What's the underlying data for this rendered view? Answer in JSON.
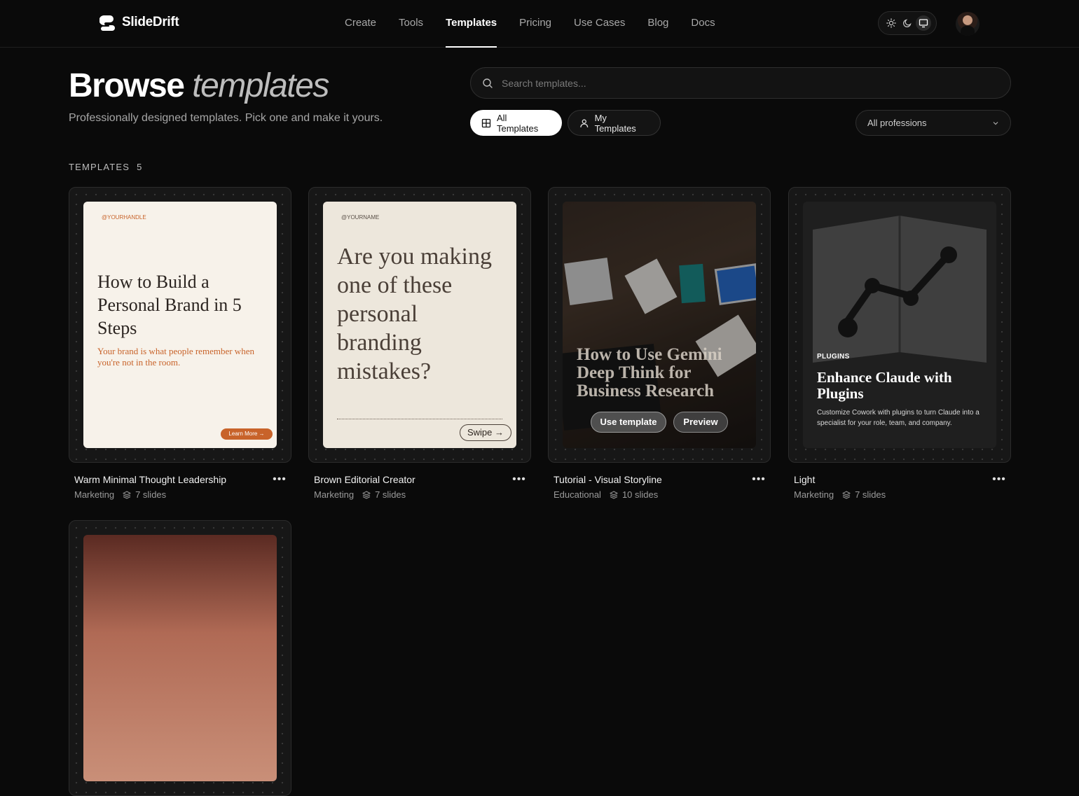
{
  "app": {
    "name": "SlideDrift"
  },
  "nav": {
    "items": [
      {
        "label": "Create",
        "active": false
      },
      {
        "label": "Tools",
        "active": false
      },
      {
        "label": "Templates",
        "active": true
      },
      {
        "label": "Pricing",
        "active": false
      },
      {
        "label": "Use Cases",
        "active": false
      },
      {
        "label": "Blog",
        "active": false
      },
      {
        "label": "Docs",
        "active": false
      }
    ],
    "theme_active": "system"
  },
  "hero": {
    "title_bold": "Browse",
    "title_italic": "templates",
    "subtitle": "Professionally designed templates. Pick one and make it yours."
  },
  "search": {
    "placeholder": "Search templates..."
  },
  "filters": {
    "all_label": "All Templates",
    "mine_label": "My Templates",
    "profession_value": "All professions"
  },
  "section": {
    "label": "TEMPLATES",
    "count": "5"
  },
  "templates": [
    {
      "name": "Warm Minimal Thought Leadership",
      "category": "Marketing",
      "slides": "7 slides",
      "thumb": {
        "handle": "@YOURHANDLE",
        "headline": "How to Build a Personal Brand in 5 Steps",
        "body": "Your brand is what people remember when you're not in the room.",
        "cta": "Learn More →"
      }
    },
    {
      "name": "Brown Editorial Creator",
      "category": "Marketing",
      "slides": "7 slides",
      "thumb": {
        "handle": "@YOURNAME",
        "headline": "Are you making one of these personal branding mistakes?",
        "cta": "Swipe →"
      }
    },
    {
      "name": "Tutorial - Visual Storyline",
      "category": "Educational",
      "slides": "10 slides",
      "thumb": {
        "headline": "How to Use Gemini Deep Think for Business Research",
        "use_label": "Use template",
        "preview_label": "Preview"
      }
    },
    {
      "name": "Light",
      "category": "Marketing",
      "slides": "7 slides",
      "thumb": {
        "tag": "PLUGINS",
        "headline": "Enhance Claude with Plugins",
        "body": "Customize Cowork with plugins to turn Claude into a specialist for your role, team, and company."
      }
    }
  ],
  "colors": {
    "accent_orange": "#c8632a",
    "background": "#0a0a0a"
  }
}
